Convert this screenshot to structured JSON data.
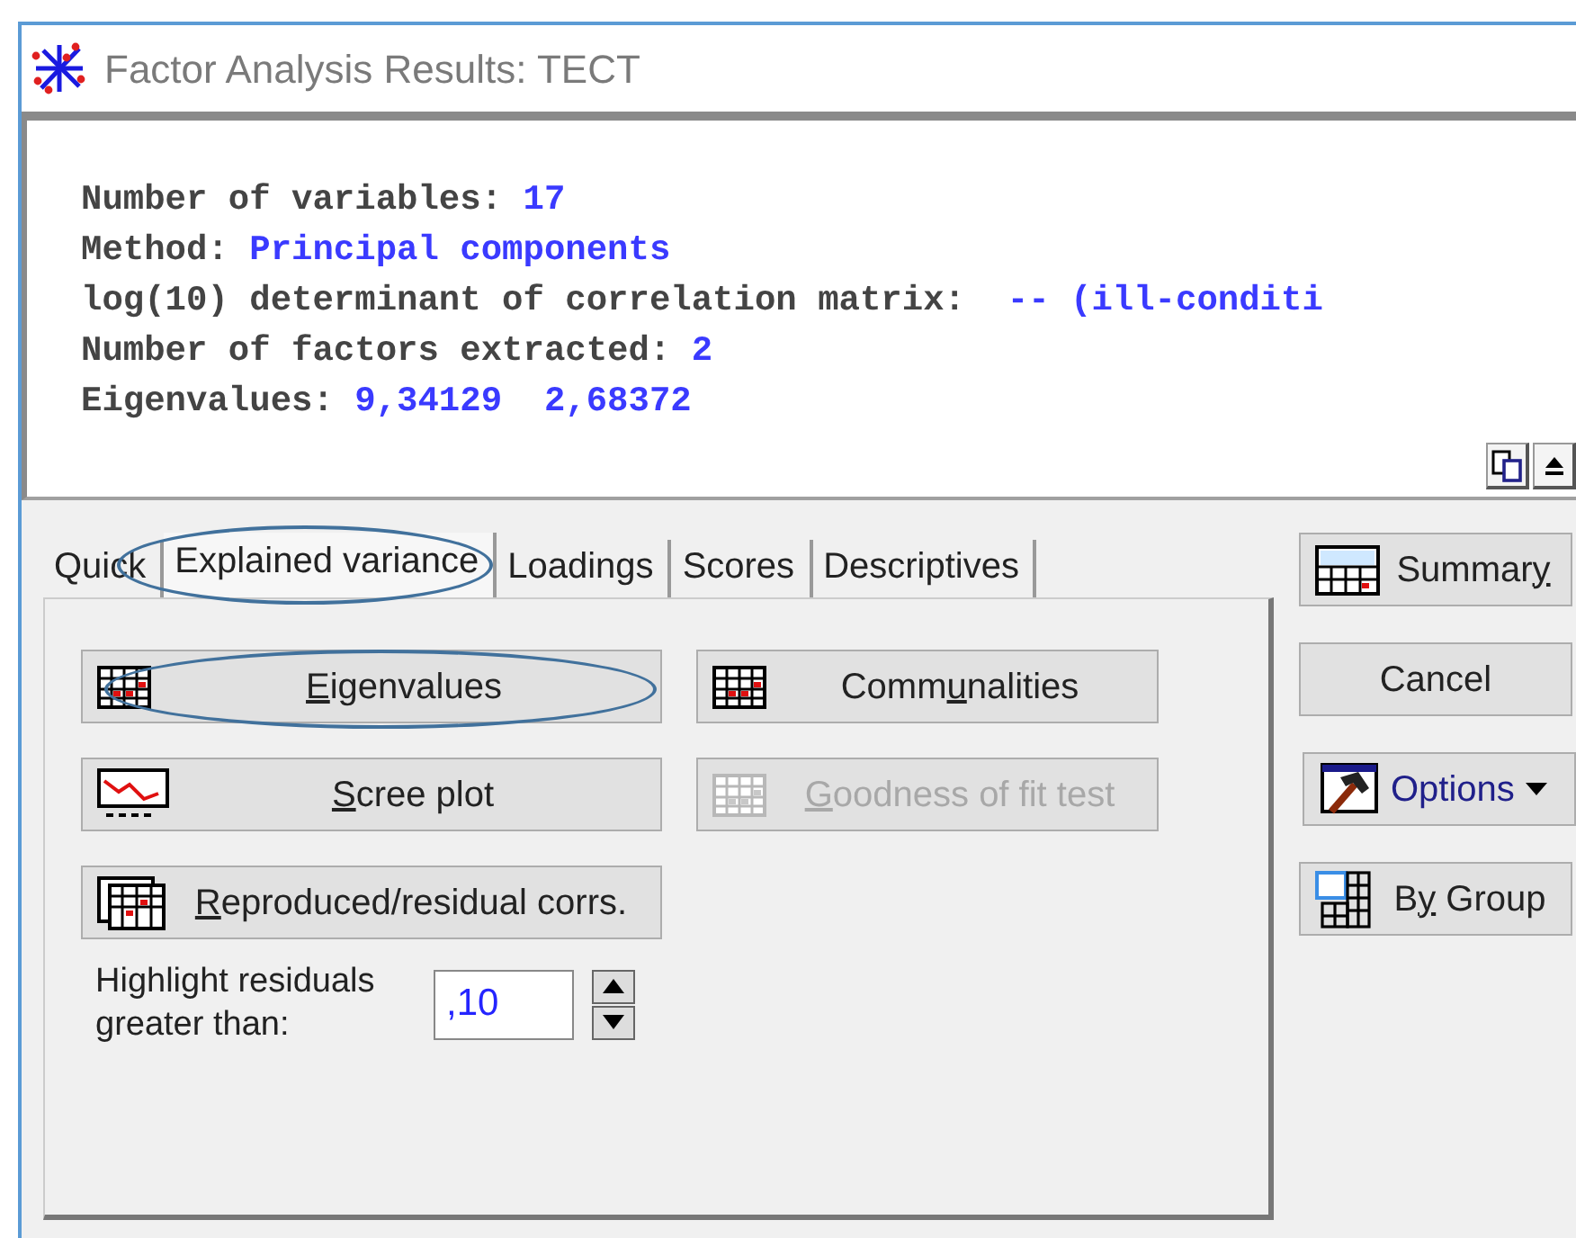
{
  "window": {
    "title": "Factor Analysis Results: TECT"
  },
  "output": {
    "lines": [
      {
        "label": "Number of variables:",
        "value": "17"
      },
      {
        "label": "Method:",
        "value": "Principal components"
      },
      {
        "label": "log(10) determinant of correlation matrix:",
        "value": " -- (ill-conditi"
      },
      {
        "label": "Number of factors extracted:",
        "value": "2"
      },
      {
        "label": "Eigenvalues:",
        "value": "9,34129  2,68372"
      }
    ]
  },
  "tabs": [
    {
      "label": "Quick",
      "selected": false,
      "circled": false
    },
    {
      "label": "Explained variance",
      "selected": true,
      "circled": true
    },
    {
      "label": "Loadings",
      "selected": false,
      "circled": false
    },
    {
      "label": "Scores",
      "selected": false,
      "circled": false
    },
    {
      "label": "Descriptives",
      "selected": false,
      "circled": false
    }
  ],
  "buttons": [
    {
      "kind": "grid",
      "key": "E",
      "post": "igenvalues",
      "disabled": false,
      "circled": true
    },
    {
      "kind": "grid",
      "pre": "Comm",
      "key": "u",
      "post": "nalities",
      "disabled": false,
      "circled": false
    },
    {
      "kind": "scree",
      "key": "S",
      "post": "cree plot",
      "disabled": false,
      "circled": false
    },
    {
      "kind": "grid",
      "key": "G",
      "post": "oodness of fit test",
      "disabled": true,
      "circled": false
    },
    {
      "kind": "stack",
      "key": "R",
      "post": "eproduced/residual corrs.",
      "disabled": false,
      "circled": false
    }
  ],
  "residual_threshold": {
    "label": "Highlight residuals greater than:",
    "value": ",10"
  },
  "side_buttons": [
    {
      "kind": "summary",
      "pre": "Summar",
      "key": "y",
      "dropdown": false
    },
    {
      "kind": "plain",
      "pre": "Cancel",
      "dropdown": false
    },
    {
      "kind": "options",
      "pre": "Options",
      "dropdown": true
    },
    {
      "kind": "bygroup",
      "pre": "B",
      "key": "y",
      "post": " Group",
      "dropdown": false
    }
  ]
}
